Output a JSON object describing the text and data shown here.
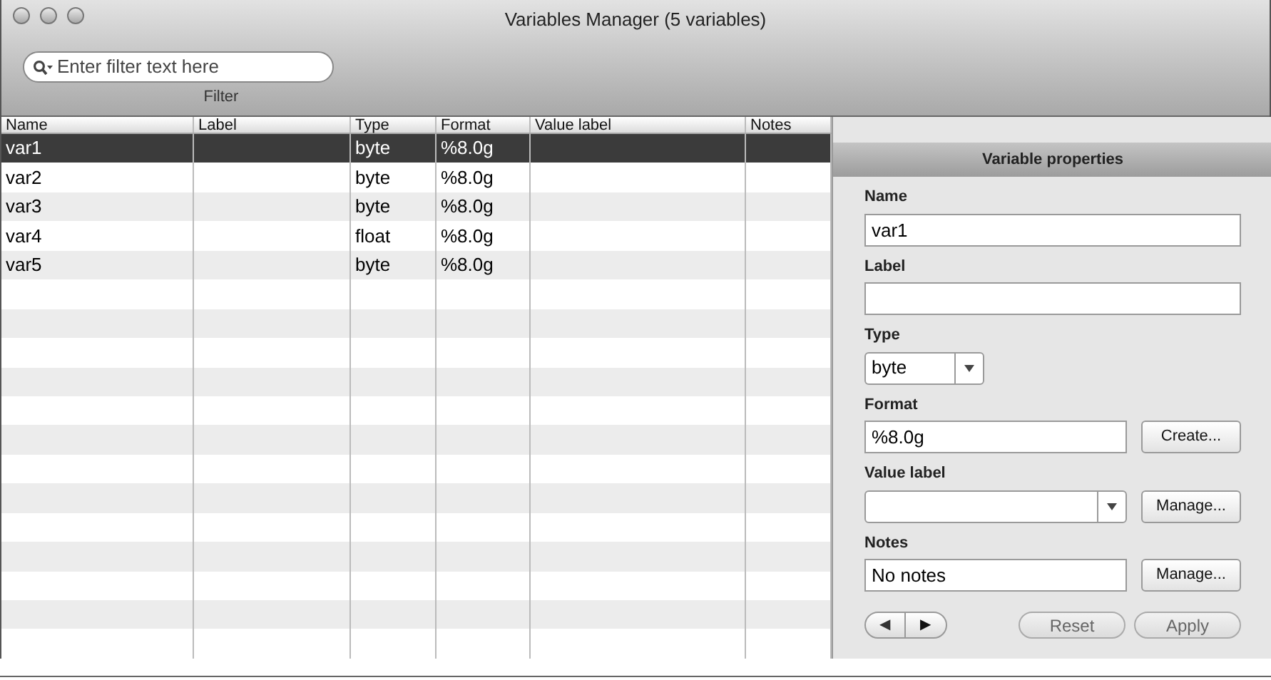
{
  "window": {
    "title": "Variables Manager (5 variables)"
  },
  "filter": {
    "placeholder": "Enter filter text here",
    "label": "Filter"
  },
  "table": {
    "columns": [
      "Name",
      "Label",
      "Type",
      "Format",
      "Value label",
      "Notes"
    ],
    "rows": [
      {
        "cells": [
          "var1",
          null,
          "byte",
          "%8.0g",
          null,
          null
        ],
        "selected": true
      },
      {
        "cells": [
          "var2",
          null,
          "byte",
          "%8.0g",
          null,
          null
        ],
        "selected": false
      },
      {
        "cells": [
          "var3",
          null,
          "byte",
          "%8.0g",
          null,
          null
        ],
        "selected": false
      },
      {
        "cells": [
          "var4",
          null,
          "float",
          "%8.0g",
          null,
          null
        ],
        "selected": false
      },
      {
        "cells": [
          "var5",
          null,
          "byte",
          "%8.0g",
          null,
          null
        ],
        "selected": false
      }
    ]
  },
  "properties": {
    "title": "Variable properties",
    "name": {
      "label": "Name",
      "value": "var1"
    },
    "label": {
      "label": "Label"
    },
    "type": {
      "label": "Type",
      "value": "byte"
    },
    "format": {
      "label": "Format",
      "value": "%8.0g",
      "button": "Create..."
    },
    "value_label": {
      "label": "Value label",
      "button": "Manage..."
    },
    "notes": {
      "label": "Notes",
      "value": "No notes",
      "button": "Manage..."
    },
    "prev": "◀",
    "next": "▶",
    "reset": "Reset",
    "apply": "Apply"
  }
}
